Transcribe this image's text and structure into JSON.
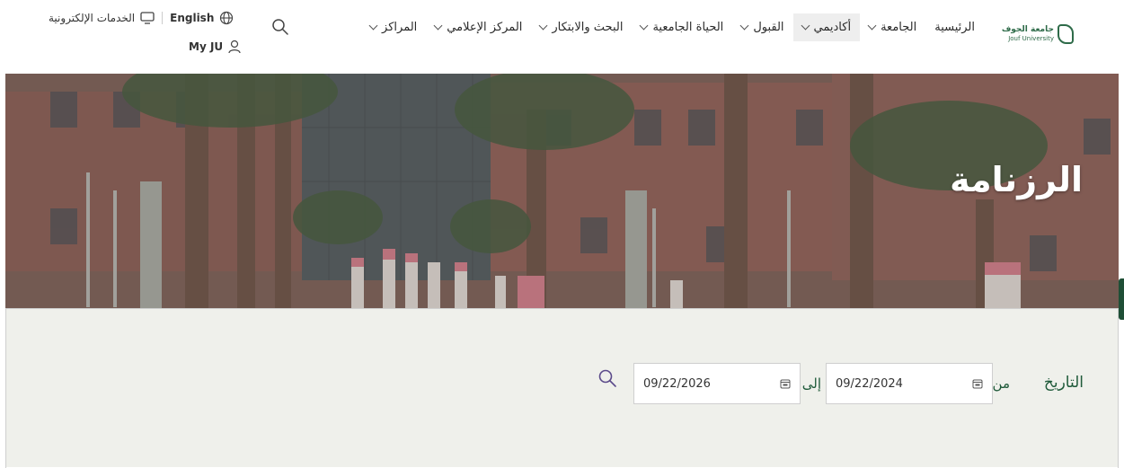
{
  "header": {
    "logo": {
      "ar": "جامعة الجوف",
      "en": "Jouf University"
    },
    "nav": [
      {
        "label": "الرئيسية",
        "has_dropdown": false
      },
      {
        "label": "الجامعة",
        "has_dropdown": true
      },
      {
        "label": "أكاديمي",
        "has_dropdown": true,
        "active": true
      },
      {
        "label": "القبول",
        "has_dropdown": true
      },
      {
        "label": "الحياة الجامعية",
        "has_dropdown": true
      },
      {
        "label": "البحث والابتكار",
        "has_dropdown": true
      },
      {
        "label": "المركز الإعلامي",
        "has_dropdown": true
      },
      {
        "label": "المراكز",
        "has_dropdown": true
      }
    ],
    "eservices_label": "الخدمات الإلكترونية",
    "language_label": "English",
    "myju_label": "My JU"
  },
  "hero": {
    "title": "الرزنامة"
  },
  "filter": {
    "date_label": "التاريخ",
    "from_label": "من",
    "to_label": "إلى",
    "from_value": "09/22/2024",
    "to_value": "09/22/2026"
  },
  "colors": {
    "brand_green": "#1f5a3a",
    "filter_bg": "#eff0eb",
    "active_nav_bg": "#eeeeee"
  },
  "icons": {
    "search": "search-icon",
    "globe": "globe-icon",
    "monitor": "monitor-icon",
    "user": "user-icon",
    "calendar": "calendar-icon",
    "chevron": "chevron-down-icon"
  }
}
